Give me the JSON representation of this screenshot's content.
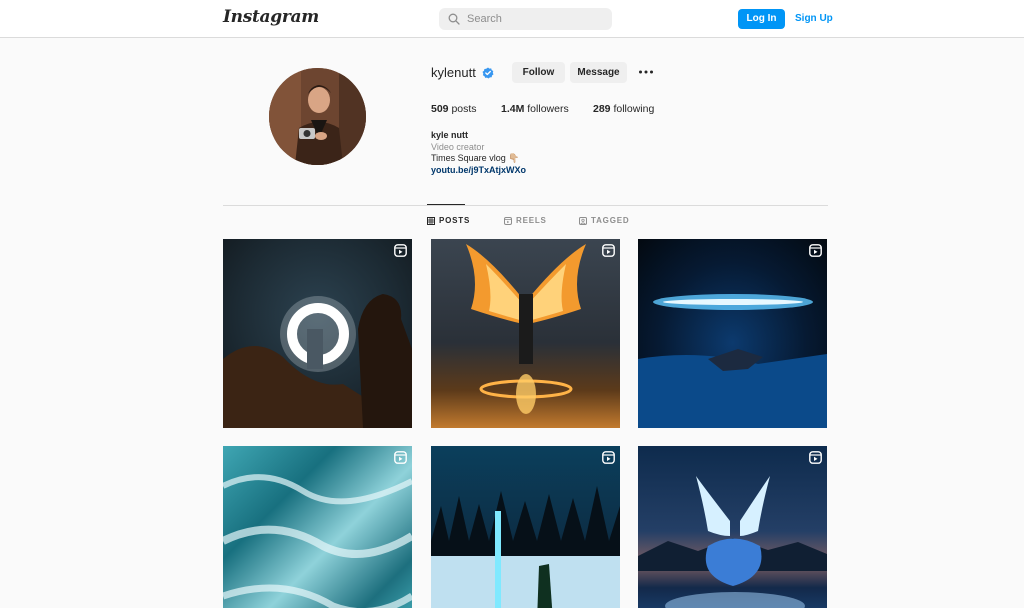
{
  "nav": {
    "logo": "Instagram",
    "search_placeholder": "Search",
    "login_label": "Log In",
    "signup_label": "Sign Up",
    "brand_color": "#0095f6"
  },
  "profile": {
    "username": "kylenutt",
    "verified_icon": "verified-badge-icon",
    "follow_label": "Follow",
    "message_label": "Message",
    "more_icon": "more-options-icon",
    "stats": {
      "posts_count": "509",
      "posts_label": "posts",
      "followers_count": "1.4M",
      "followers_label": "followers",
      "following_count": "289",
      "following_label": "following"
    },
    "bio": {
      "name": "kyle nutt",
      "category": "Video creator",
      "text": "Times Square vlog 👇🏼",
      "link": "youtu.be/j9TxAtjxWXo"
    }
  },
  "tabs": [
    {
      "label": "POSTS",
      "icon": "grid-icon",
      "active": true
    },
    {
      "label": "REELS",
      "icon": "reels-icon",
      "active": false
    },
    {
      "label": "TAGGED",
      "icon": "tagged-icon",
      "active": false
    }
  ],
  "posts": [
    {
      "type": "reel",
      "icon": "reel-icon"
    },
    {
      "type": "reel",
      "icon": "reel-icon"
    },
    {
      "type": "reel",
      "icon": "reel-icon"
    },
    {
      "type": "reel",
      "icon": "reel-icon"
    },
    {
      "type": "reel",
      "icon": "reel-icon"
    },
    {
      "type": "reel",
      "icon": "reel-icon"
    }
  ]
}
